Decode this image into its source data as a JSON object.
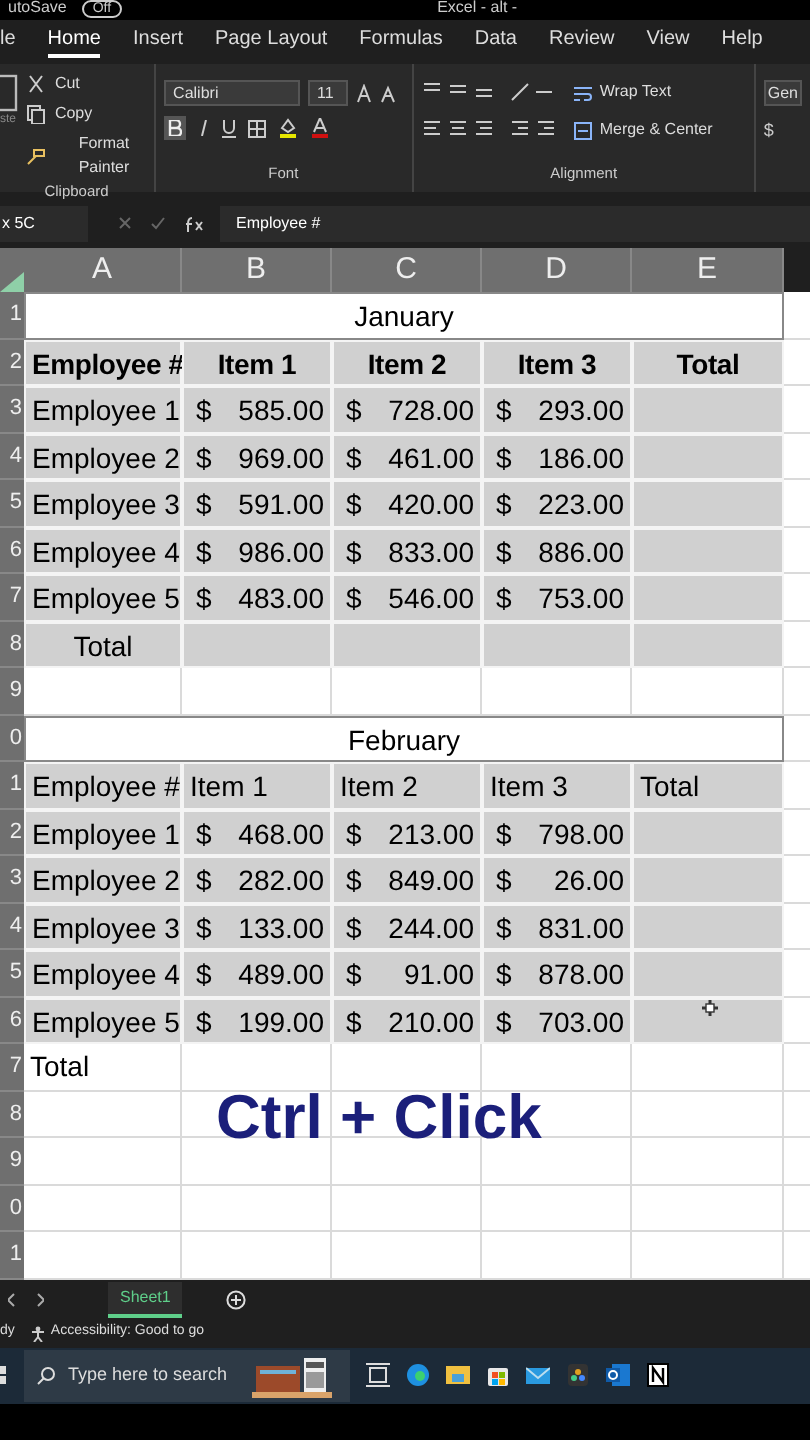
{
  "title_bar": {
    "autosave": "utoSave",
    "toggle": "Off",
    "title": "Excel - alt - "
  },
  "ribbon_tabs": [
    {
      "label": "le",
      "selected": false
    },
    {
      "label": "Home",
      "selected": true
    },
    {
      "label": "Insert",
      "selected": false
    },
    {
      "label": "Page Layout",
      "selected": false
    },
    {
      "label": "Formulas",
      "selected": false
    },
    {
      "label": "Data",
      "selected": false
    },
    {
      "label": "Review",
      "selected": false
    },
    {
      "label": "View",
      "selected": false
    },
    {
      "label": "Help",
      "selected": false
    }
  ],
  "clipboard": {
    "paste": "ste",
    "cut": "Cut",
    "copy": "Copy",
    "format_painter": "Format Painter",
    "group": "Clipboard"
  },
  "font": {
    "name": "Calibri",
    "size": "11",
    "bold_on": true,
    "group": "Font"
  },
  "alignment": {
    "wrap": "Wrap Text",
    "merge": "Merge & Center",
    "group": "Alignment"
  },
  "number": {
    "format": "Gen",
    "currency": "$"
  },
  "formula_bar": {
    "name_box": "x 5C",
    "content": "Employee #"
  },
  "columns": [
    "A",
    "B",
    "C",
    "D",
    "E"
  ],
  "rows": [
    {
      "header": "1",
      "kind": "title",
      "text": "January"
    },
    {
      "header": "2",
      "kind": "data",
      "shaded": true,
      "bold": true,
      "cells": [
        {
          "text": "Employee #"
        },
        {
          "text": "Item 1"
        },
        {
          "text": "Item 2"
        },
        {
          "text": "Item 3"
        },
        {
          "text": "Total"
        }
      ]
    },
    {
      "header": "3",
      "kind": "data",
      "shaded": true,
      "bold": false,
      "cells": [
        {
          "text": "Employee 1"
        },
        {
          "symbol": "$",
          "amount": "585.00"
        },
        {
          "symbol": "$",
          "amount": "728.00"
        },
        {
          "symbol": "$",
          "amount": "293.00"
        },
        {}
      ]
    },
    {
      "header": "4",
      "kind": "data",
      "shaded": true,
      "bold": false,
      "cells": [
        {
          "text": "Employee 2"
        },
        {
          "symbol": "$",
          "amount": "969.00"
        },
        {
          "symbol": "$",
          "amount": "461.00"
        },
        {
          "symbol": "$",
          "amount": "186.00"
        },
        {}
      ]
    },
    {
      "header": "5",
      "kind": "data",
      "shaded": true,
      "bold": false,
      "cells": [
        {
          "text": "Employee 3"
        },
        {
          "symbol": "$",
          "amount": "591.00"
        },
        {
          "symbol": "$",
          "amount": "420.00"
        },
        {
          "symbol": "$",
          "amount": "223.00"
        },
        {}
      ]
    },
    {
      "header": "6",
      "kind": "data",
      "shaded": true,
      "bold": false,
      "cells": [
        {
          "text": "Employee 4"
        },
        {
          "symbol": "$",
          "amount": "986.00"
        },
        {
          "symbol": "$",
          "amount": "833.00"
        },
        {
          "symbol": "$",
          "amount": "886.00"
        },
        {}
      ]
    },
    {
      "header": "7",
      "kind": "data",
      "shaded": true,
      "bold": false,
      "cells": [
        {
          "text": "Employee 5"
        },
        {
          "symbol": "$",
          "amount": "483.00"
        },
        {
          "symbol": "$",
          "amount": "546.00"
        },
        {
          "symbol": "$",
          "amount": "753.00"
        },
        {}
      ]
    },
    {
      "header": "8",
      "kind": "data",
      "shaded": true,
      "bold": false,
      "cells": [
        {
          "text": "Total",
          "centered": true
        },
        {},
        {},
        {},
        {}
      ]
    },
    {
      "header": "9",
      "kind": "blank"
    },
    {
      "header": "0",
      "kind": "title",
      "text": "February"
    },
    {
      "header": "1",
      "kind": "data",
      "shaded": true,
      "bold": false,
      "cells": [
        {
          "text": "Employee #"
        },
        {
          "text": "Item 1"
        },
        {
          "text": "Item 2"
        },
        {
          "text": "Item 3"
        },
        {
          "text": "Total"
        }
      ]
    },
    {
      "header": "2",
      "kind": "data",
      "shaded": true,
      "bold": false,
      "cells": [
        {
          "text": "Employee 1"
        },
        {
          "symbol": "$",
          "amount": "468.00"
        },
        {
          "symbol": "$",
          "amount": "213.00"
        },
        {
          "symbol": "$",
          "amount": "798.00"
        },
        {}
      ]
    },
    {
      "header": "3",
      "kind": "data",
      "shaded": true,
      "bold": false,
      "cells": [
        {
          "text": "Employee 2"
        },
        {
          "symbol": "$",
          "amount": "282.00"
        },
        {
          "symbol": "$",
          "amount": "849.00"
        },
        {
          "symbol": "$",
          "amount": "26.00"
        },
        {}
      ]
    },
    {
      "header": "4",
      "kind": "data",
      "shaded": true,
      "bold": false,
      "cells": [
        {
          "text": "Employee 3"
        },
        {
          "symbol": "$",
          "amount": "133.00"
        },
        {
          "symbol": "$",
          "amount": "244.00"
        },
        {
          "symbol": "$",
          "amount": "831.00"
        },
        {}
      ]
    },
    {
      "header": "5",
      "kind": "data",
      "shaded": true,
      "bold": false,
      "cells": [
        {
          "text": "Employee 4"
        },
        {
          "symbol": "$",
          "amount": "489.00"
        },
        {
          "symbol": "$",
          "amount": "91.00"
        },
        {
          "symbol": "$",
          "amount": "878.00"
        },
        {}
      ]
    },
    {
      "header": "6",
      "kind": "data",
      "shaded": true,
      "bold": false,
      "cells": [
        {
          "text": "Employee 5"
        },
        {
          "symbol": "$",
          "amount": "199.00"
        },
        {
          "symbol": "$",
          "amount": "210.00"
        },
        {
          "symbol": "$",
          "amount": "703.00"
        },
        {}
      ]
    },
    {
      "header": "7",
      "kind": "data",
      "shaded": false,
      "bold": false,
      "cells": [
        {
          "text": "Total"
        },
        {},
        {},
        {},
        {}
      ]
    },
    {
      "header": "8",
      "kind": "blank"
    },
    {
      "header": "9",
      "kind": "blank"
    },
    {
      "header": "0",
      "kind": "blank"
    },
    {
      "header": "1",
      "kind": "blank"
    }
  ],
  "caption": "Ctrl + Click",
  "sheet_tabs": [
    {
      "label": "Sheet1",
      "selected": true
    }
  ],
  "status_bar": {
    "mode": "dy",
    "accessibility": "Accessibility: Good to go"
  },
  "taskbar": {
    "search_placeholder": "Type here to search"
  }
}
